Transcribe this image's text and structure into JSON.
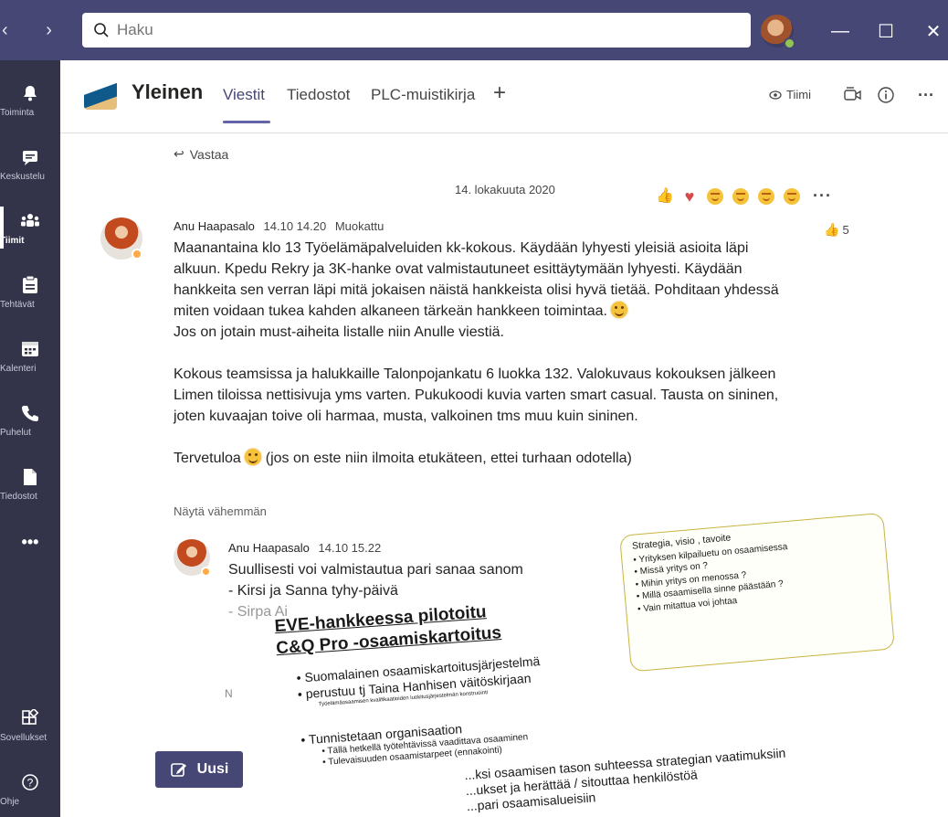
{
  "titlebar": {
    "search_placeholder": "Haku",
    "nav_arrows": "‹ ›",
    "chevron": "⌄",
    "min": "—",
    "max": "☐",
    "close": "✕"
  },
  "rail": {
    "items": [
      {
        "label": "Toiminta",
        "icon": "bell-icon"
      },
      {
        "label": "Keskustelu",
        "icon": "chat-icon"
      },
      {
        "label": "Tiimit",
        "icon": "teams-icon",
        "active": true
      },
      {
        "label": "Tehtävät",
        "icon": "tasks-icon"
      },
      {
        "label": "Kalenteri",
        "icon": "calendar-icon"
      },
      {
        "label": "Puhelut",
        "icon": "phone-icon"
      },
      {
        "label": "Tiedostot",
        "icon": "files-icon"
      },
      {
        "label": "•••",
        "icon": "more-icon"
      },
      {
        "label": "Sovellukset",
        "icon": "apps-icon"
      },
      {
        "label": "Ohje",
        "icon": "help-icon"
      }
    ]
  },
  "header": {
    "channel_name": "Yleinen",
    "tabs": [
      "Viestit",
      "Tiedostot",
      "PLC-muistikirja"
    ],
    "add_tab": "+",
    "team_label": "Tiimi",
    "more": "···"
  },
  "thread": {
    "reply_label": "Vastaa",
    "date": "14. lokakuuta 2020",
    "reactions_more": "···",
    "message": {
      "author": "Anu Haapasalo",
      "time": "14.10 14.20",
      "edited": "Muokattu",
      "likes": "5",
      "p1_lines": [
        "Maanantaina klo 13 Työelämäpalveluiden kk-kokous. Käydään lyhyesti yleisiä asioita läpi",
        "alkuun. Kpedu Rekry ja 3K-hanke ovat valmistautuneet esittäytymään lyhyesti. Käydään",
        "hankkeita sen verran läpi mitä jokaisen näistä hankkeista olisi hyvä tietää. Pohditaan yhdessä",
        "miten voidaan tukea kahden alkaneen tärkeän hankkeen toimintaa."
      ],
      "p1_last": "Jos on jotain must-aiheita listalle niin Anulle viestiä.",
      "p2_lines": [
        "Kokous teamsissa ja halukkaille Talonpojankatu 6 luokka 132. Valokuvaus kokouksen jälkeen",
        "Limen tiloissa nettisivuja yms varten. Pukukoodi kuvia varten smart casual. Tausta on sininen,",
        "joten kuvaajan toive oli harmaa, musta, valkoinen tms muu kuin sininen."
      ],
      "p3_before": "Tervetuloa",
      "p3_after": "(jos on este niin ilmoita etukäteen, ettei turhaan odotella)"
    },
    "show_less": "Näytä vähemmän",
    "reply": {
      "author": "Anu Haapasalo",
      "time": "14.10 15.22",
      "line1": "Suullisesti voi valmistautua pari sanaa sanom",
      "line2": "- Kirsi ja Sanna tyhy-päivä",
      "line3": "- Sirpa Ai"
    },
    "small_n": "N"
  },
  "new_post": {
    "label": "Uusi"
  },
  "slide": {
    "title_line1": "EVE-hankkeessa pilotoitu",
    "title_line2": "C&Q Pro -osaamiskartoitus",
    "bullets": [
      {
        "level": 1,
        "text": "Suomalainen osaamiskartoitusjärjestelmä"
      },
      {
        "level": 1,
        "text": "perustuu tj Taina Hanhisen väitöskirjaan"
      },
      {
        "level": 3,
        "text": "Työelämäosaamisen kvalifikaatioiden luokitusjärjestelmän konstruointi"
      },
      {
        "level": 0,
        "text": ""
      },
      {
        "level": 1,
        "text": "Tunnistetaan organisaation"
      },
      {
        "level": 2,
        "text": "Tällä hetkellä työtehtävissä vaadittava osaaminen"
      },
      {
        "level": 2,
        "text": "Tulevaisuuden osaamistarpeet (ennakointi)"
      }
    ],
    "bottom_line": "...ksi osaamisen tason suhteessa strategian vaatimuksiin",
    "bottom_line2": "...ukset ja herättää / sitouttaa henkilöstöä",
    "bottom_line3": "...pari osaamisalueisiin"
  },
  "sticky": {
    "title": "Strategia, visio , tavoite",
    "items": [
      "• Yrityksen kilpailuetu on osaamisessa",
      "• Missä yritys on ?",
      "• Mihin yritys on menossa ?",
      "• Millä osaamisella sinne päästään ?",
      "• Vain mitattua voi johtaa"
    ]
  },
  "colors": {
    "titlebar": "#464775",
    "rail": "#33344a",
    "accent": "#6264a7",
    "presence_available": "#92c353",
    "presence_away": "#ffaa44"
  }
}
